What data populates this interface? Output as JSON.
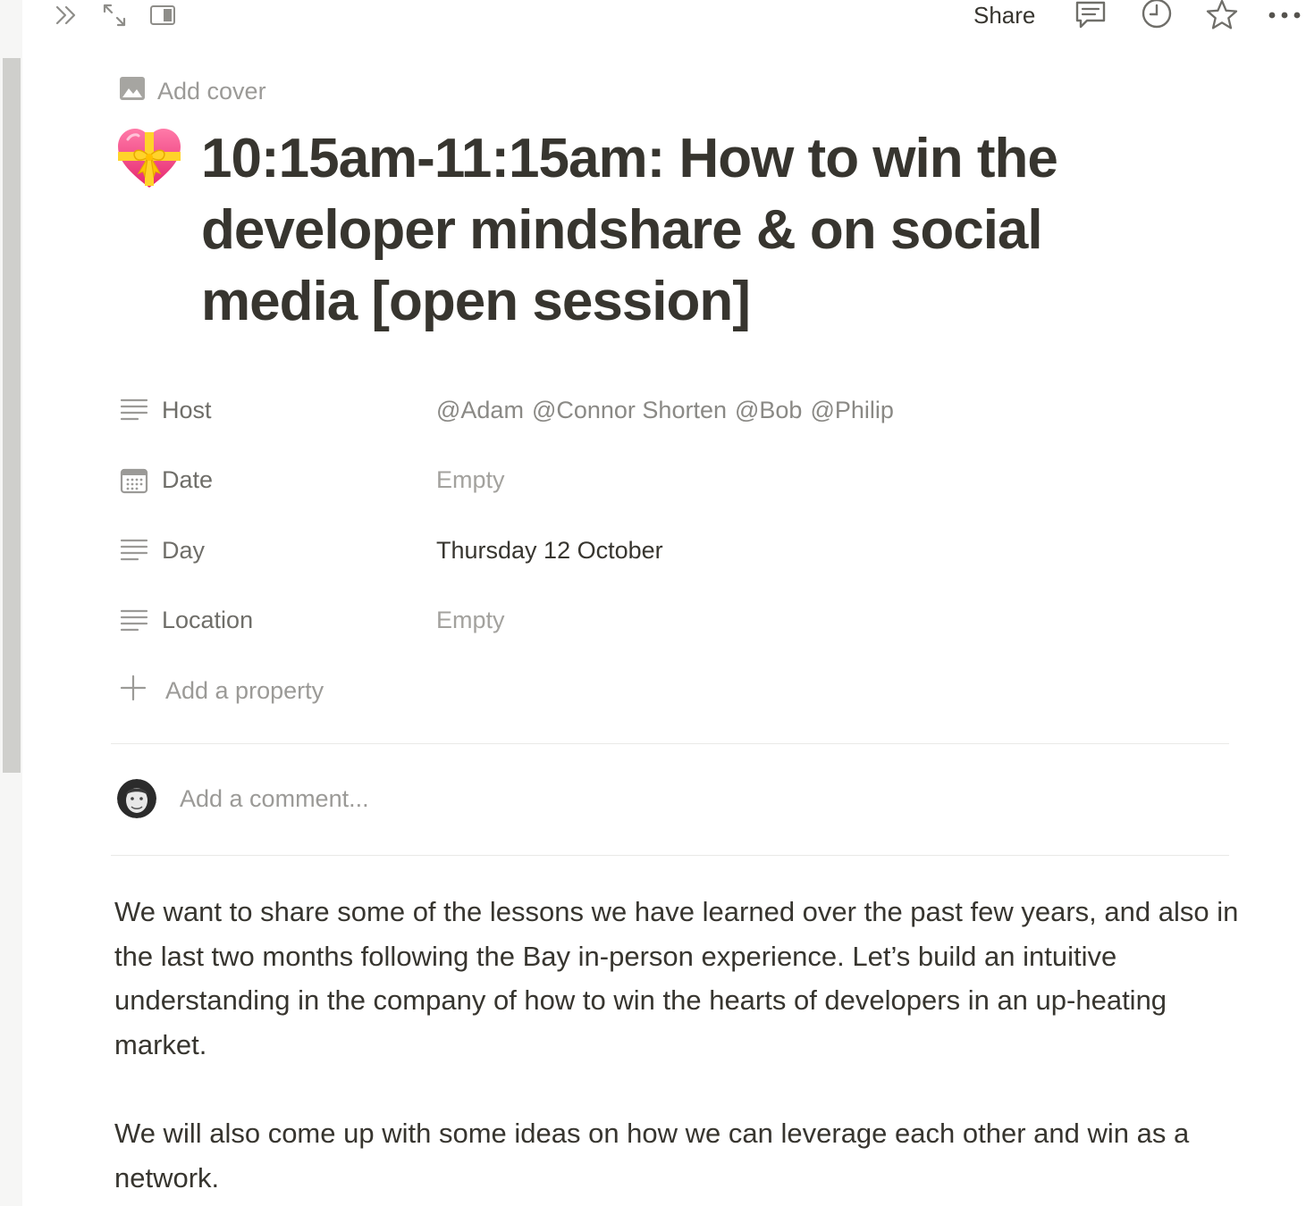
{
  "topbar": {
    "share_label": "Share"
  },
  "page": {
    "add_cover_label": "Add cover",
    "emoji": "heart-with-ribbon",
    "title": "10:15am-11:15am: How to win the developer mindshare & on social media [open session]"
  },
  "properties": [
    {
      "key": "Host",
      "icon": "text-lines-icon",
      "mentions": [
        "@Adam",
        "@Connor Shorten",
        "@Bob",
        "@Philip"
      ]
    },
    {
      "key": "Date",
      "icon": "calendar-icon",
      "value": "Empty"
    },
    {
      "key": "Day",
      "icon": "text-lines-icon",
      "value": "Thursday 12 October"
    },
    {
      "key": "Location",
      "icon": "text-lines-icon",
      "value": "Empty"
    }
  ],
  "add_property_label": "Add a property",
  "comment": {
    "placeholder": "Add a comment..."
  },
  "body": {
    "paragraph_1": "We want to share some of the lessons we have learned over the past few years, and also in the last two months following the Bay in-person experience. Let’s build an intuitive understanding in the company of how to win the hearts of developers in an up-heating market.",
    "paragraph_2": "We will also come up with some ideas on how we can leverage each other and win as a network."
  }
}
